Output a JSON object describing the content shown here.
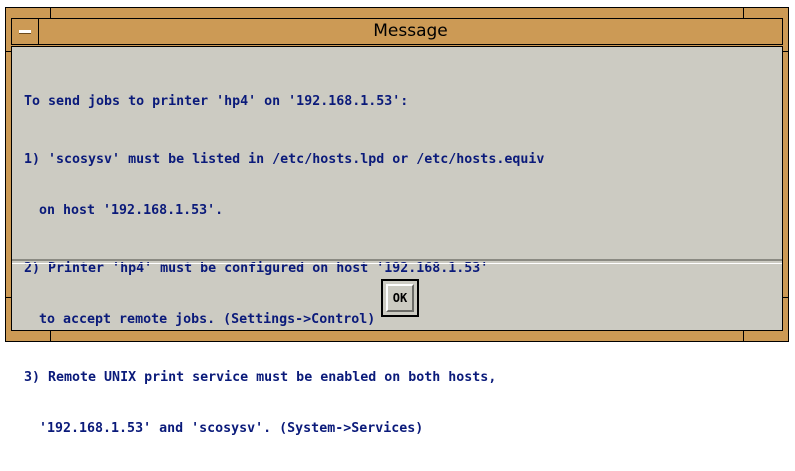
{
  "window": {
    "title": "Message"
  },
  "message": {
    "lines": [
      "To send jobs to printer 'hp4' on '192.168.1.53':",
      "1) 'scosysv' must be listed in /etc/hosts.lpd or /etc/hosts.equiv",
      "on host '192.168.1.53'.",
      "2) Printer 'hp4' must be configured on host '192.168.1.53'",
      "to accept remote jobs. (Settings->Control)",
      "3) Remote UNIX print service must be enabled on both hosts,",
      "'192.168.1.53' and 'scosysv'. (System->Services)"
    ]
  },
  "buttons": {
    "ok_label": "OK"
  },
  "colors": {
    "frame": "#cc9a55",
    "client_bg": "#cccbc2",
    "message_text": "#0a1a7a"
  },
  "icons": {
    "window_menu": "window-menu-icon"
  }
}
